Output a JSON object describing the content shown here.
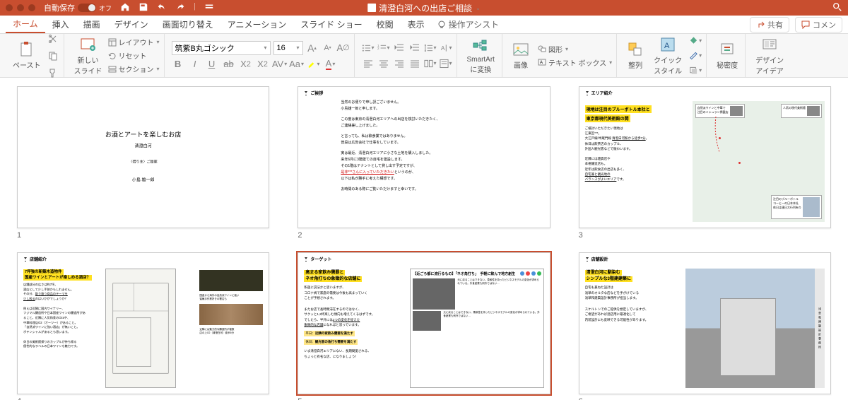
{
  "titlebar": {
    "autosave_label": "自動保存",
    "autosave_state": "オフ",
    "filename": "清澄白河への出店ご相談"
  },
  "tabs": {
    "items": [
      "ホーム",
      "挿入",
      "描画",
      "デザイン",
      "画面切り替え",
      "アニメーション",
      "スライド ショー",
      "校閲",
      "表示"
    ],
    "active": 0,
    "tell_me": "操作アシスト",
    "share": "共有",
    "comments": "コメン"
  },
  "ribbon": {
    "paste": "ペースト",
    "new_slide": "新しい\nスライド",
    "layout": "レイアウト",
    "reset": "リセット",
    "section": "セクション",
    "font_name": "筑紫B丸ゴシック",
    "font_size": "16",
    "smartart": "SmartArt\nに変換",
    "picture": "画像",
    "shape": "図形",
    "textbox": "テキスト ボックス",
    "arrange": "整列",
    "quickstyle": "クイック\nスタイル",
    "sensitivity": "秘密度",
    "designideas": "デザイン\nアイデア"
  },
  "slides": {
    "s1": {
      "title": "お酒とアートを楽しむお店",
      "subtitle": "清澄白河",
      "proposal": "〈借り主〉ご提案",
      "author": "小島 雄一郎"
    },
    "s2": {
      "header": "ご挨拶",
      "l1": "当然のお便りで申し訳ございません。",
      "l2": "小島雄一郎と申します。",
      "l3": "この度は東京の清澄白河エリアへの出店を検討いただきたく、",
      "l4": "ご連絡差し上げました。",
      "l5": "と言っても、私は飲食業ではありません。",
      "l6": "普段は広告会社で仕事をしています。",
      "l7": "実は最近、清澄白河エリアに小さな土地を購入しました。",
      "l8": "来年6月に3階建ての自宅を建設します。",
      "l9": "その1階はテナントとして貸し出す予定ですが、",
      "l9red": "是非***さんに入っていただきたい",
      "l9end": "というのが、",
      "l10": "以下は私が勝手に考えた構想です。",
      "l11": "お時間のある際にご覧いただけますと幸いです。"
    },
    "s3": {
      "header": "エリア紹介",
      "hl1": "現地は注目のブルーボトル本社と",
      "hl2": "東京都現代美術館の間",
      "b1": "ご検討いただきたい現地は",
      "b2": "江東区***。",
      "b3a": "大江戸線/半蔵門線 ",
      "b3u": "清澄白河駅から徒歩7分",
      "b4": "休日は飲茶店のカップル、",
      "b5": "外国人観光客などで賑わいます。",
      "b6": "近隣には雑貨店や",
      "b7": "本格醸造店も。",
      "b8": "近年は飲食店の出店も多く、",
      "b9u": "自宅兼と観光地の",
      "b10u": "バランスがよいエリア",
      "b10e": "です。",
      "card1a": "自然派ワインと中華で",
      "card1b": "注目のミシュラン掲載店",
      "card2": "人気の現代美術館",
      "card3a": "注目のブルーボトル",
      "card3b": "コーヒーの日本本社",
      "card3c": "休日は連日大行列有り"
    },
    "s4": {
      "header": "店舗紹介",
      "hl1": "7坪強の新築木造物件",
      "hl2": "国産ワインとアートが楽しめる酒店？",
      "b1": "店舗部分の広さは約7坪。",
      "b2a": "酒店として少し手狭かもしれません。",
      "b2b": "その分、",
      "b2u": "取り扱う商品のテーマを",
      "b3u": "少し絞る",
      "b3e": "のはいかがでしょうか？",
      "b4": "例えば近隣に国内ワイナリー、",
      "b5": "フジマル醸造所や日本国産ワインの醸造所があ",
      "b6": "ること。近隣に人気和食のOzaや、",
      "b7": "中華料理店O2（オーツー）があること。",
      "b8": "「自然派ワインに強い酒店」が無いこと。",
      "b8e": "ポテンシャルがあるとも思います。",
      "b9": "休日の美術館帰りのカップルが持ち帰る",
      "b10": "個性的なラベルの日本ワインも魅力です。",
      "cap1": "国産から海外の自然派ワインに強い",
      "cap2": "蜜蝋手作業好きの署名も",
      "cap3": "近隣には魅力的な醸造所が複数",
      "cap4": "店の上O2（清澄白河）徒歩5分"
    },
    "s5": {
      "header": "ターゲット",
      "hl1": "高まる家飲み需要と",
      "hl2": "ネオ角打ちの象徴的な店舗に",
      "b1": "釈迦に説法かと思いますが、",
      "b2": "コロナ禍で家庭の需要は今後も高まっていく",
      "b3": "ことが予想されます。",
      "b4": "またお店で長時間滞在するのではなく、",
      "b5a": "サクッと1,2杯楽しむ傾向も増えてくるはずです。",
      "b5b": "でしたら、半外には",
      "b5u": "2つの変化を捉えた",
      "b6u": "象徴的な店舗",
      "b6e": "になればと思っています。",
      "badge1a": "平日：",
      "badge1b": "近隣の家飲み需要を満たす",
      "badge2a": "休日：",
      "badge2b": "観光客の角打ち需要を満たす",
      "b7": "いま清澄白河エリアにない、長期間愛される、",
      "b8": "ちょっと有名な店、になりましょう！",
      "news_t1": "【近ごろ都に流行るもの】「ネオ角打ち」　手軽に飲んで地方創生",
      "news_body": "元に戻ることはできない。柔軟性を持ったビジネスモデルの変化が求められている。外食産業も例外ではない…"
    },
    "s6": {
      "header": "店舗設計",
      "hl1": "清澄白河に馴染む",
      "hl2": "シンプルな3階建建築に",
      "b1": "自宅も兼ねた設計は",
      "b2": "浅草のオルタな店などを手がけている",
      "b3": "浅草和建築設計事務所が担当します。",
      "b4": "スケルトンでのご提供を想定していますが、",
      "b5": "ご希望があれば酒店用に最適化して",
      "b6": "内装設計にも反映できる可能性があります。",
      "side": "浅草和建築設計事務所"
    }
  }
}
